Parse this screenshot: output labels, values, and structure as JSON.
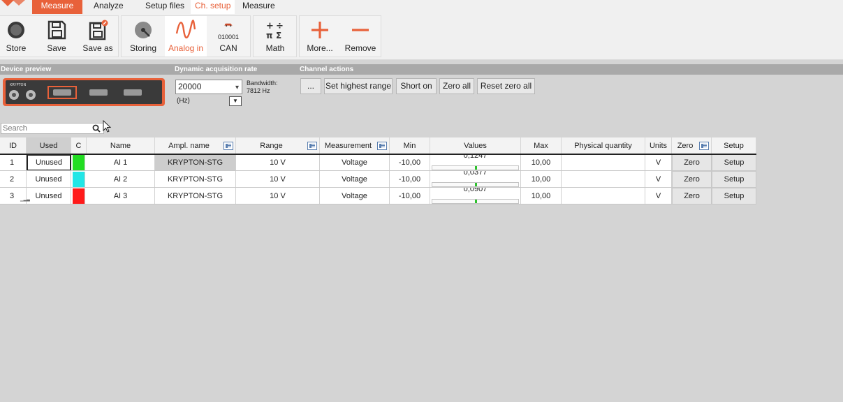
{
  "menu": {
    "items": [
      {
        "label": "Measure",
        "style": "active"
      },
      {
        "label": "Analyze",
        "style": ""
      },
      {
        "label": "Setup files",
        "style": ""
      },
      {
        "label": "Ch. setup",
        "style": "orange-text"
      },
      {
        "label": "Measure",
        "style": ""
      }
    ]
  },
  "ribbon": {
    "store": "Store",
    "save": "Save",
    "save_as": "Save as",
    "storing": "Storing",
    "analog_in": "Analog in",
    "can": "CAN",
    "can_bits": "010001",
    "math": "Math",
    "more": "More...",
    "remove": "Remove"
  },
  "sections": {
    "device_preview": "Device preview",
    "acq_rate": "Dynamic acquisition rate",
    "channel_actions": "Channel actions"
  },
  "device": {
    "brand": "KRYPTON"
  },
  "rate": {
    "value": "20000",
    "unit": "(Hz)",
    "bandwidth_label": "Bandwidth:",
    "bandwidth_value": "7812 Hz"
  },
  "actions": {
    "more": "...",
    "set_highest_range": "Set highest range",
    "short_on": "Short on",
    "zero_all": "Zero all",
    "reset_zero_all": "Reset zero all"
  },
  "search": {
    "placeholder": "Search"
  },
  "table": {
    "headers": {
      "id": "ID",
      "used": "Used",
      "c": "C",
      "name": "Name",
      "ampl_name": "Ampl. name",
      "range": "Range",
      "measurement": "Measurement",
      "min": "Min",
      "values": "Values",
      "max": "Max",
      "physical_quantity": "Physical quantity",
      "units": "Units",
      "zero": "Zero",
      "setup": "Setup"
    },
    "rows": [
      {
        "id": "1",
        "used": "Unused",
        "color": "#22dd22",
        "name": "AI  1",
        "ampl": "KRYPTON-STG",
        "range": "10 V",
        "measurement": "Voltage",
        "min": "-10,00",
        "value": "0,1247",
        "value_fraction": 0.506,
        "max": "10,00",
        "phys": "",
        "units": "V",
        "zero": "Zero",
        "setup": "Setup"
      },
      {
        "id": "2",
        "used": "Unused",
        "color": "#22e6e6",
        "name": "AI  2",
        "ampl": "KRYPTON-STG",
        "range": "10 V",
        "measurement": "Voltage",
        "min": "-10,00",
        "value": "0,0377",
        "value_fraction": 0.502,
        "max": "10,00",
        "phys": "",
        "units": "V",
        "zero": "Zero",
        "setup": "Setup"
      },
      {
        "id": "3",
        "used": "Unused",
        "color": "#ff1a1a",
        "name": "AI  3",
        "ampl": "KRYPTON-STG",
        "range": "10 V",
        "measurement": "Voltage",
        "min": "-10,00",
        "value": "0,0907",
        "value_fraction": 0.505,
        "max": "10,00",
        "phys": "",
        "units": "V",
        "zero": "Zero",
        "setup": "Setup"
      }
    ]
  }
}
